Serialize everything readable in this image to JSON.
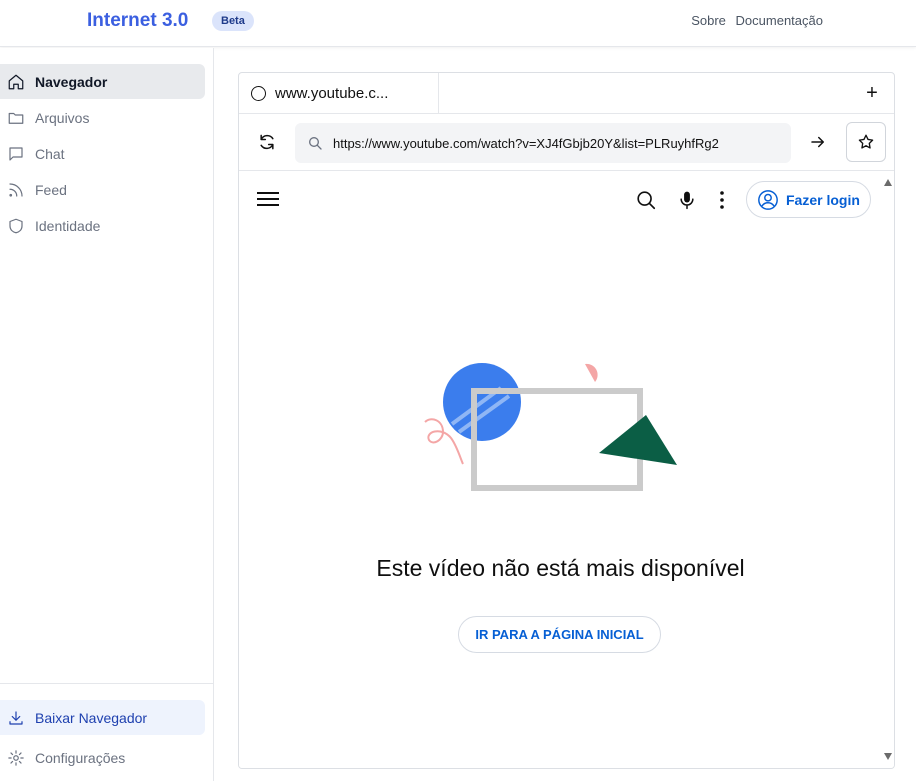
{
  "header": {
    "brand": "Internet 3.0",
    "badge": "Beta",
    "links": [
      "Sobre",
      "Documentação"
    ]
  },
  "sidebar": {
    "items": [
      {
        "label": "Navegador",
        "icon": "home-icon",
        "active": true
      },
      {
        "label": "Arquivos",
        "icon": "folder-icon"
      },
      {
        "label": "Chat",
        "icon": "chat-icon"
      },
      {
        "label": "Feed",
        "icon": "rss-icon"
      },
      {
        "label": "Identidade",
        "icon": "shield-icon"
      }
    ],
    "bottom": [
      {
        "label": "Baixar Navegador",
        "icon": "download-icon"
      },
      {
        "label": "Configurações",
        "icon": "gear-icon"
      }
    ]
  },
  "browser": {
    "tab_title": "www.youtube.c...",
    "url": "https://www.youtube.com/watch?v=XJ4fGbjb20Y&list=PLRuyhfRg2",
    "new_tab_label": "+"
  },
  "youtube": {
    "login_label": "Fazer login",
    "message": "Este vídeo não está mais disponível",
    "home_button": "IR PARA A PÁGINA INICIAL"
  },
  "colors": {
    "brand": "#3b5fe0",
    "link_blue": "#065fd4",
    "active_nav_bg": "#e8eaed",
    "download_bg": "#eef3fd"
  }
}
